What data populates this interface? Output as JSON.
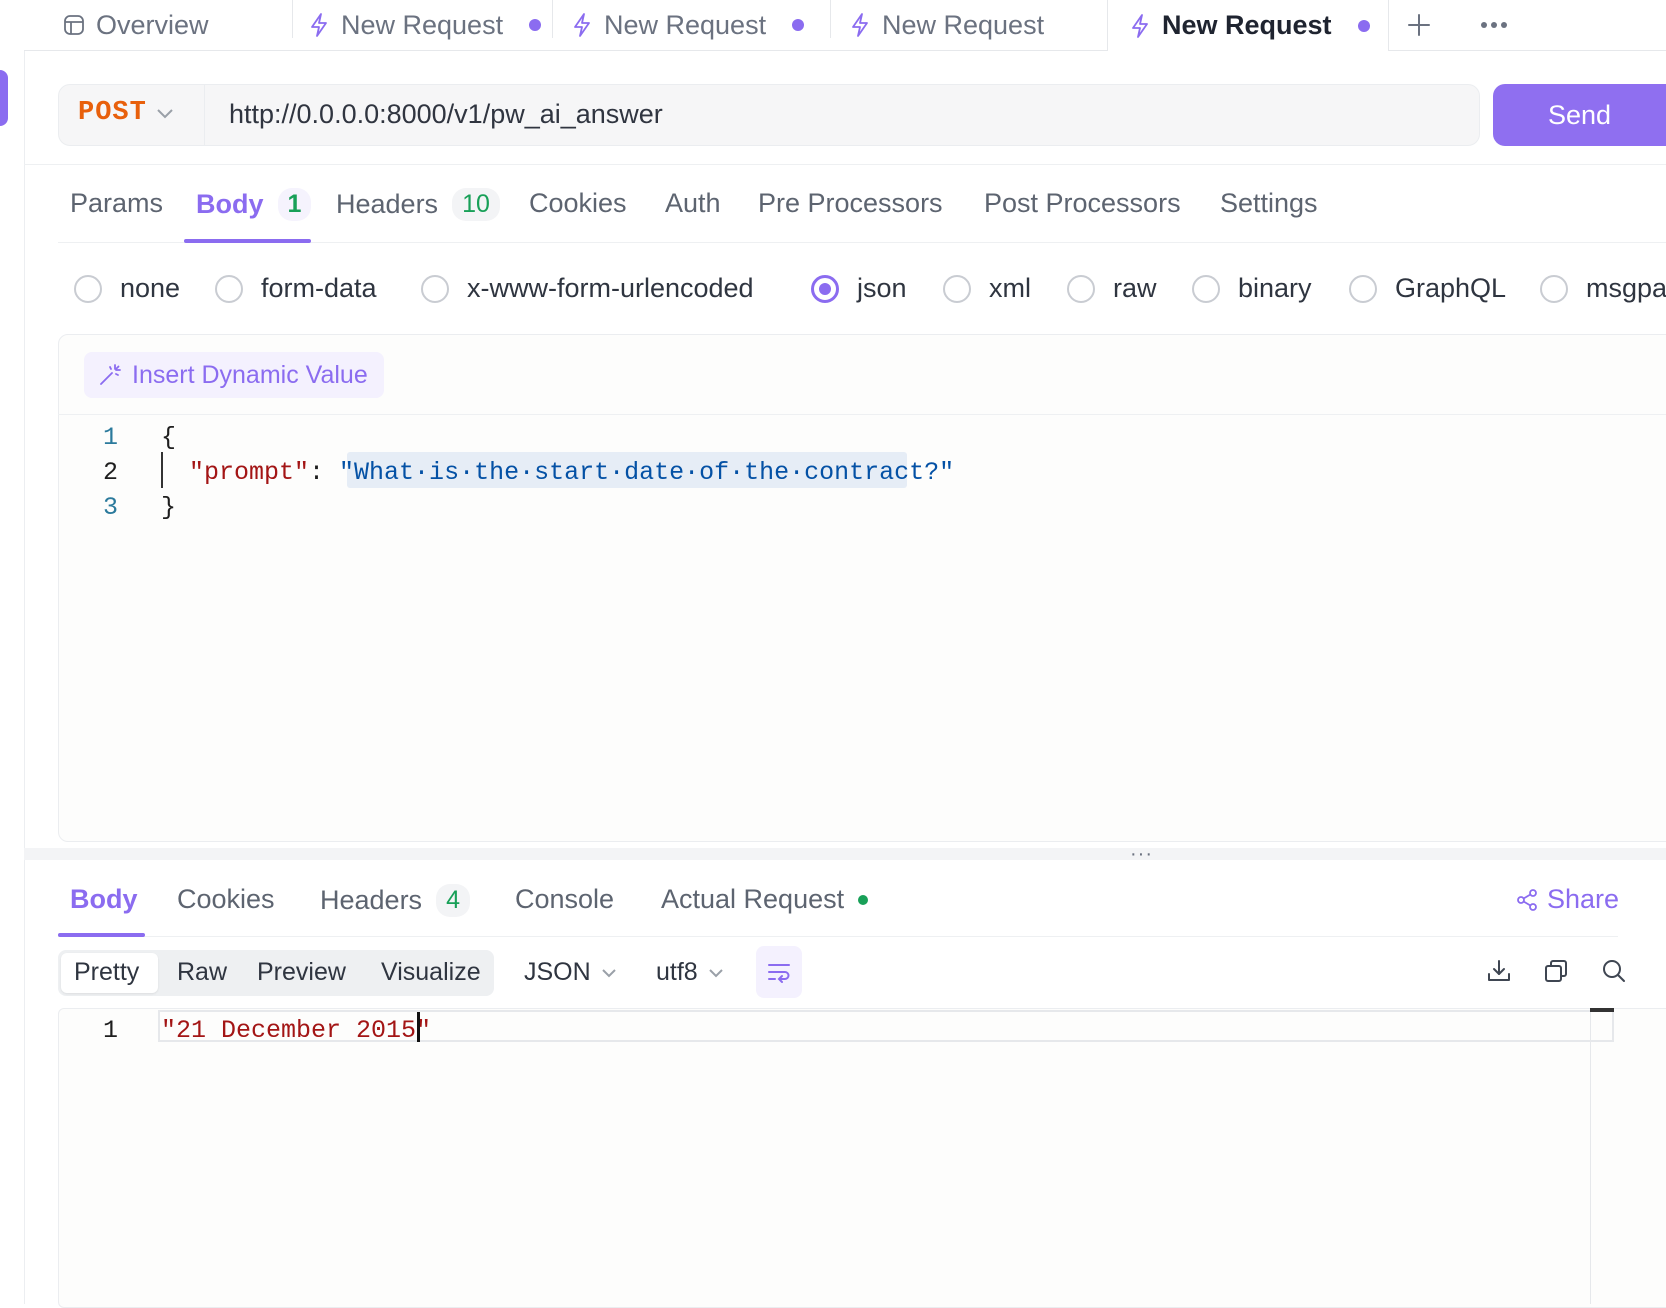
{
  "tabs": {
    "overview": "Overview",
    "items": [
      {
        "label": "New Request",
        "unsaved": true
      },
      {
        "label": "New Request",
        "unsaved": true
      },
      {
        "label": "New Request",
        "unsaved": false
      },
      {
        "label": "New Request",
        "unsaved": true,
        "active": true
      }
    ],
    "add_icon": "plus-icon",
    "more_icon": "more-horizontal-icon"
  },
  "request": {
    "method": "POST",
    "url": "http://0.0.0.0:8000/v1/pw_ai_answer",
    "send_label": "Send"
  },
  "request_tabs": [
    {
      "label": "Params"
    },
    {
      "label": "Body",
      "count": "1",
      "active": true
    },
    {
      "label": "Headers",
      "count": "10"
    },
    {
      "label": "Cookies"
    },
    {
      "label": "Auth"
    },
    {
      "label": "Pre Processors"
    },
    {
      "label": "Post Processors"
    },
    {
      "label": "Settings"
    }
  ],
  "body_types": {
    "options": [
      "none",
      "form-data",
      "x-www-form-urlencoded",
      "json",
      "xml",
      "raw",
      "binary",
      "GraphQL",
      "msgpa"
    ],
    "selected": "json"
  },
  "editor": {
    "insert_dynamic_label": "Insert Dynamic Value",
    "line_numbers": [
      "1",
      "2",
      "3"
    ],
    "open_brace": "{",
    "key": "\"prompt\"",
    "colon": ": ",
    "value": "\"What·is·the·start·date·of·the·contract?\"",
    "close_brace": "}"
  },
  "response_tabs": {
    "body": "Body",
    "cookies": "Cookies",
    "headers": "Headers",
    "headers_count": "4",
    "console": "Console",
    "actual_request": "Actual Request",
    "share": "Share"
  },
  "response_view": {
    "modes": [
      "Pretty",
      "Raw",
      "Preview",
      "Visualize"
    ],
    "format": "JSON",
    "encoding": "utf8"
  },
  "response": {
    "line_number": "1",
    "value": "\"21 December 2015\""
  },
  "colors": {
    "accent": "#8b6cf0",
    "method": "#e8600c",
    "count_green": "#18a058",
    "string_blue": "#0451a5",
    "key_red": "#a31515"
  }
}
